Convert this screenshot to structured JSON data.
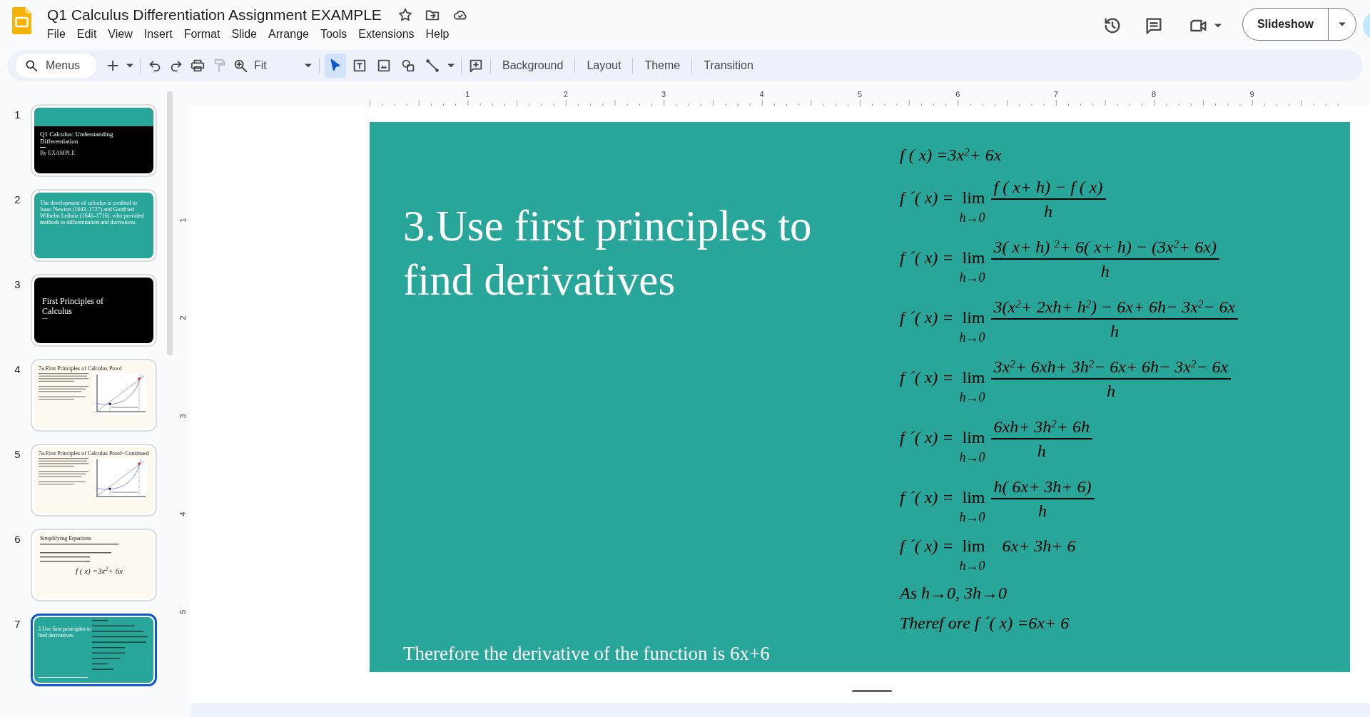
{
  "document": {
    "title": "Q1 Calculus Differentiation Assignment EXAMPLE"
  },
  "menu": [
    "File",
    "Edit",
    "View",
    "Insert",
    "Format",
    "Slide",
    "Arrange",
    "Tools",
    "Extensions",
    "Help"
  ],
  "slideshow_button": "Slideshow",
  "toolbar": {
    "search_placeholder": "Menus",
    "zoom": "Fit",
    "actions": [
      {
        "kind": "add",
        "disabled": false
      },
      {
        "kind": "undo",
        "disabled": false
      },
      {
        "kind": "redo",
        "disabled": false
      },
      {
        "kind": "print",
        "disabled": false
      },
      {
        "kind": "paint_format",
        "disabled": true
      },
      {
        "kind": "zoom",
        "disabled": false
      }
    ],
    "tools": [
      {
        "kind": "select",
        "selected": true
      },
      {
        "kind": "textbox",
        "selected": false
      },
      {
        "kind": "image",
        "selected": false
      },
      {
        "kind": "shape",
        "selected": false
      },
      {
        "kind": "line",
        "selected": false
      }
    ],
    "buttons": [
      "Background",
      "Layout",
      "Theme",
      "Transition"
    ]
  },
  "rulers": {
    "horizontal": [
      "1",
      "2",
      "3",
      "4",
      "5",
      "6",
      "7",
      "8",
      "9"
    ],
    "vertical": [
      "1",
      "2",
      "3",
      "4",
      "5"
    ]
  },
  "slides": [
    {
      "number": "1",
      "kind": "title",
      "selected": false,
      "title": "Q1 Calculus: Understanding Differentiation",
      "subtitle": "By EXAMPLE"
    },
    {
      "number": "2",
      "kind": "text",
      "selected": false,
      "body": "The development of calculus is credited to Isaac Newton (1643–1727) and Gottfried Wilhelm Leibniz (1646–1716), who provided methods to differentiation and derivatives."
    },
    {
      "number": "3",
      "kind": "section",
      "selected": false,
      "title": "First Principles of Calculus"
    },
    {
      "number": "4",
      "kind": "graph",
      "selected": false,
      "title": "7a.First Principles of Calculus Proof"
    },
    {
      "number": "5",
      "kind": "graph",
      "selected": false,
      "title": "7a.First Principles of Calculus Proof- Continued"
    },
    {
      "number": "6",
      "kind": "simplify",
      "selected": false,
      "title": "Simplifying Equations",
      "result": "f ( x) =3x$^{2}$+ 6x"
    },
    {
      "number": "7",
      "kind": "derivation",
      "selected": true,
      "title": "3.Use first principles to find derivatives"
    }
  ],
  "current_slide": {
    "title": "3.Use first principles to find derivatives",
    "footer": "Therefore the derivative of the function is 6x+6",
    "equations": [
      {
        "kind": "plain",
        "text": "f ( x) =3x$^{2}$+ 6x"
      },
      {
        "kind": "limit",
        "lhs": "f ´( x) =",
        "operator": "lim",
        "under": "h→0",
        "numerator": "f ( x+ h) − f ( x)",
        "denominator": "h"
      },
      {
        "kind": "limit",
        "lhs": "f ´( x) =",
        "operator": "lim",
        "under": "h→0",
        "numerator": "3( x+ h) $^{2}$+ 6( x+ h) − (3x$^{2}$+ 6x)",
        "denominator": "h"
      },
      {
        "kind": "limit",
        "lhs": "f ´( x) =",
        "operator": "lim",
        "under": "h→0",
        "numerator": "3(x$^{2}$+ 2xh+ h$^{2}$) − 6x+ 6h− 3x$^{2}$− 6x",
        "denominator": "h"
      },
      {
        "kind": "limit",
        "lhs": "f ´( x) =",
        "operator": "lim",
        "under": "h→0",
        "numerator": "3x$^{2}$+ 6xh+ 3h$^{2}$− 6x+ 6h− 3x$^{2}$− 6x",
        "denominator": "h"
      },
      {
        "kind": "limit",
        "lhs": "f ´( x) =",
        "operator": "lim",
        "under": "h→0",
        "numerator": "6xh+ 3h$^{2}$+ 6h",
        "denominator": "h"
      },
      {
        "kind": "limit",
        "lhs": "f ´( x) =",
        "operator": "lim",
        "under": "h→0",
        "numerator": "h( 6x+ 3h+ 6)",
        "denominator": "h"
      },
      {
        "kind": "limit_expr",
        "lhs": "f ´( x) =",
        "operator": "lim",
        "under": "h→0",
        "expression": "6x+ 3h+ 6"
      },
      {
        "kind": "plain",
        "text": "As h→0, 3h→0"
      },
      {
        "kind": "plain",
        "text": "Theref ore f ´( x) =6x+ 6"
      }
    ]
  }
}
